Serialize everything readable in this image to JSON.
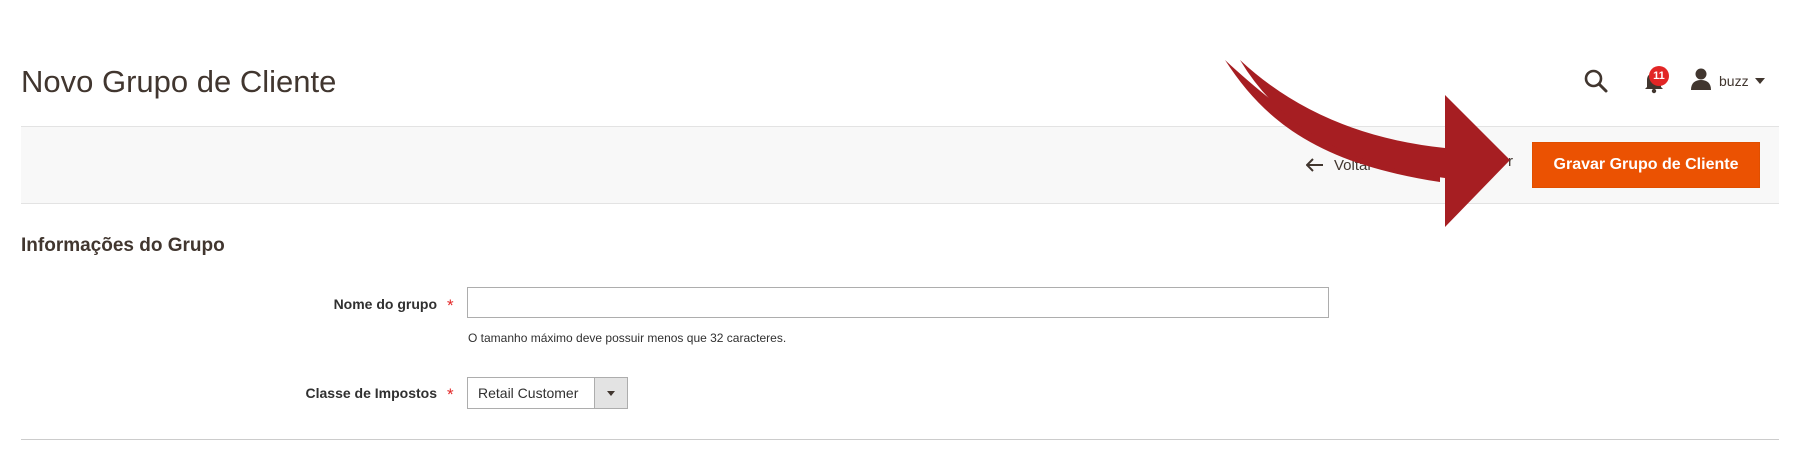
{
  "page": {
    "title": "Novo Grupo de Cliente"
  },
  "header": {
    "notifications_count": "11",
    "user_name": "buzz"
  },
  "actions": {
    "back_label": "Voltar",
    "reset_label": "r",
    "save_label": "Gravar Grupo de Cliente",
    "save_color": "#eb5202"
  },
  "section": {
    "title": "Informações do Grupo"
  },
  "form": {
    "group_name": {
      "label": "Nome do grupo",
      "required": "*",
      "value": "",
      "note": "O tamanho máximo deve possuir menos que 32 caracteres."
    },
    "tax_class": {
      "label": "Classe de Impostos",
      "required": "*",
      "selected": "Retail Customer"
    }
  },
  "annotation": {
    "arrow_color": "#a61e22"
  }
}
